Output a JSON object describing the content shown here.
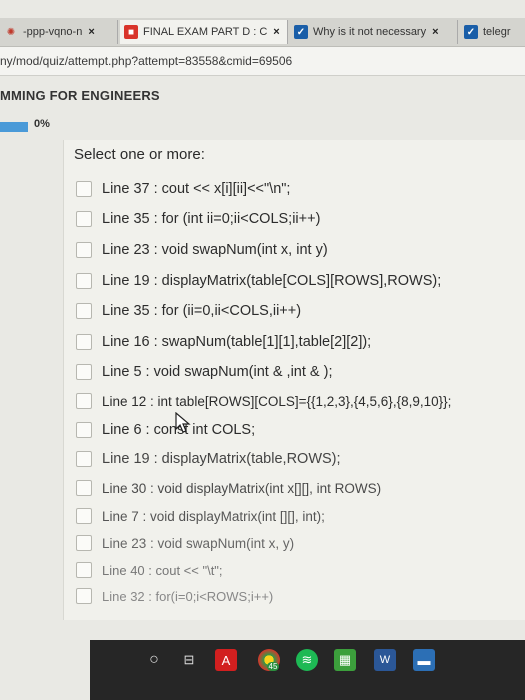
{
  "browser": {
    "tabs": [
      {
        "title": "-ppp-vqno-n",
        "close": "×"
      },
      {
        "title": "FINAL EXAM PART D : C",
        "close": "×"
      },
      {
        "title": "Why is it not necessary",
        "close": "×"
      },
      {
        "title": "telegr",
        "close": ""
      }
    ],
    "url": "ny/mod/quiz/attempt.php?attempt=83558&cmid=69506"
  },
  "course": {
    "title": "MMING FOR ENGINEERS"
  },
  "progress": {
    "label": "0%",
    "value": 0
  },
  "question": {
    "prompt": "Select one or more:",
    "options": [
      "Line 37 : cout << x[i][ii]<<\"\\n\";",
      "Line 35 : for (int ii=0;ii<COLS;ii++)",
      "Line 23 : void swapNum(int x, int y)",
      "Line 19 : displayMatrix(table[COLS][ROWS],ROWS);",
      "Line 35 : for (ii=0,ii<COLS,ii++)",
      "Line 16 : swapNum(table[1][1],table[2][2]);",
      "Line 5 : void swapNum(int & ,int & );",
      "Line 12 : int table[ROWS][COLS]={{1,2,3},{4,5,6},{8,9,10}};",
      "Line 6 : const int COLS;",
      "Line 19 : displayMatrix(table,ROWS);",
      "Line 30 : void displayMatrix(int x[][], int ROWS)",
      "Line 7 : void displayMatrix(int [][], int);",
      "Line 23 : void swapNum(int x, y)",
      "Line 40 : cout << \"\\t\";",
      "Line 32 : for(i=0;i<ROWS;i++)"
    ]
  },
  "taskbar": {
    "icons": [
      "cortana-icon",
      "task-view-icon",
      "acrobat-icon",
      "chrome-icon",
      "spotify-icon",
      "files-icon",
      "word-icon",
      "app-icon"
    ],
    "badge": "45"
  }
}
